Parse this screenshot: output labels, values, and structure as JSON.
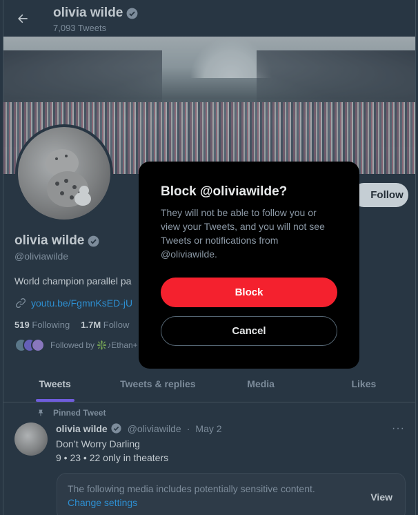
{
  "header": {
    "title": "olivia wilde",
    "subtitle": "7,093 Tweets"
  },
  "profile": {
    "name": "olivia wilde",
    "handle": "@oliviawilde",
    "bio": "World champion parallel pa",
    "link": "youtu.be/FgmnKsED-jU",
    "following_count": "519",
    "following_label": "Following",
    "followers_count": "1.7M",
    "followers_label": "Follow",
    "followed_by": "Followed by ❇️♪Ethan+",
    "follow_button": "Follow"
  },
  "tabs": [
    {
      "label": "Tweets",
      "active": true
    },
    {
      "label": "Tweets & replies",
      "active": false
    },
    {
      "label": "Media",
      "active": false
    },
    {
      "label": "Likes",
      "active": false
    }
  ],
  "tweet": {
    "pinned_label": "Pinned Tweet",
    "name": "olivia wilde",
    "handle": "@oliviawilde",
    "separator": "·",
    "date": "May 2",
    "more": "···",
    "line1": "Don’t Worry Darling",
    "line2": "9 • 23 • 22 only in theaters",
    "sensitive_text": "The following media includes potentially sensitive content.",
    "sensitive_link": "Change settings",
    "sensitive_view": "View"
  },
  "dialog": {
    "title": "Block @oliviawilde?",
    "body": "They will not be able to follow you or view your Tweets, and you will not see Tweets or notifications from @oliviawilde.",
    "confirm": "Block",
    "cancel": "Cancel"
  },
  "colors": {
    "background": "#15202b",
    "accent": "#7856ff",
    "link": "#1d9bf0",
    "danger": "#f4212e",
    "dialog": "#000000"
  },
  "icons": {
    "back": "arrow-left-icon",
    "verified": "verified-badge-icon",
    "link": "link-icon",
    "pin": "pin-icon",
    "more": "more-icon"
  }
}
